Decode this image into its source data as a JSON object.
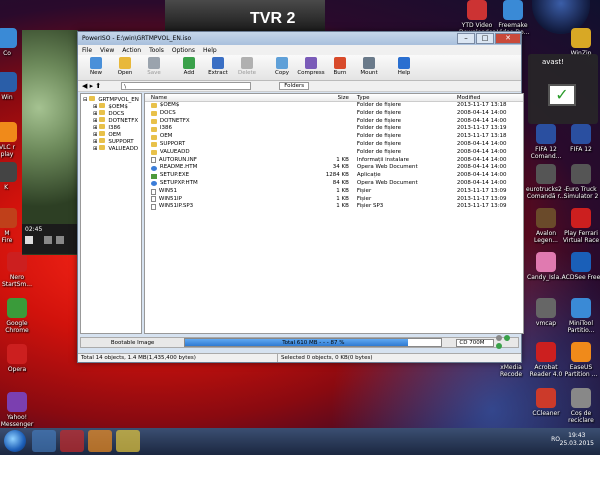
{
  "desktop": {
    "left_icons": [
      {
        "label": "Co",
        "color": "#3a8ad6"
      },
      {
        "label": "Win",
        "color": "#2a5ea8"
      },
      {
        "label": "VLC r\nplay",
        "color": "#f08a1a"
      },
      {
        "label": "K ",
        "color": "#444"
      },
      {
        "label": "M\nFire",
        "color": "#c0401a"
      },
      {
        "label": "Nero\nStartSm...",
        "color": "#cc1f1f"
      },
      {
        "label": "Google\nChrome",
        "color": "#3a9b3a"
      },
      {
        "label": "Opera",
        "color": "#cc1f1f"
      },
      {
        "label": "Yahoo!\nMessenger",
        "color": "#7b3fb0"
      }
    ],
    "right_icons": [
      {
        "label": "YTD Video\nDownloader",
        "color": "#cc3333"
      },
      {
        "label": "Freemake\nVideo Do...",
        "color": "#3a8ad6"
      },
      {
        "label": "WinZip",
        "color": "#d8a825"
      },
      {
        "label": "FIFA 12\nComand...",
        "color": "#2a4fa0"
      },
      {
        "label": "FIFA 12",
        "color": "#2a4fa0"
      },
      {
        "label": "eurotrucks2 -\nComandă r...",
        "color": "#555"
      },
      {
        "label": "Euro Truck\nSimulator 2",
        "color": "#555"
      },
      {
        "label": "Avalon\nLegen...",
        "color": "#6a4a2a"
      },
      {
        "label": "Play Ferrari\nVirtual Race",
        "color": "#cc1f1f"
      },
      {
        "label": "Candy_Isla...",
        "color": "#e07ab0"
      },
      {
        "label": "ACDSee Free",
        "color": "#1a5fb8"
      },
      {
        "label": "vmcap",
        "color": "#666"
      },
      {
        "label": "MiniTool\nPartitio...",
        "color": "#3a8ad6"
      },
      {
        "label": "xMedia\nRecode",
        "color": "#3a3a3a"
      },
      {
        "label": "Acrobat\nReader 4.0",
        "color": "#cc1f1f"
      },
      {
        "label": "EaseUS\nPartition ...",
        "color": "#f08a1a"
      },
      {
        "label": "CCleaner",
        "color": "#cc3a2a"
      },
      {
        "label": "Coș de\nreciclare",
        "color": "#888"
      }
    ],
    "avast_label": "avast!",
    "tv_logo": "TVR 2"
  },
  "video": {
    "time": "02:45"
  },
  "window": {
    "title": "PowerISO - E:\\win\\GRTMPVOL_EN.iso",
    "menu": [
      "File",
      "View",
      "Action",
      "Tools",
      "Options",
      "Help"
    ],
    "toolbar": [
      {
        "label": "New",
        "icon": "new-icon",
        "color": "#4a90d9",
        "enabled": true
      },
      {
        "label": "Open",
        "icon": "open-folder-icon",
        "color": "#e8b83a",
        "enabled": true
      },
      {
        "label": "Save",
        "icon": "save-icon",
        "color": "#9aa3ad",
        "enabled": false
      },
      {
        "label": "Add",
        "icon": "add-icon",
        "color": "#3aa14a",
        "enabled": true
      },
      {
        "label": "Extract",
        "icon": "extract-icon",
        "color": "#3a6fc4",
        "enabled": true
      },
      {
        "label": "Delete",
        "icon": "delete-icon",
        "color": "#b0b0b0",
        "enabled": false
      },
      {
        "label": "Copy",
        "icon": "copy-icon",
        "color": "#5fa0d8",
        "enabled": true
      },
      {
        "label": "Compress",
        "icon": "compress-icon",
        "color": "#7a5bb8",
        "enabled": true
      },
      {
        "label": "Burn",
        "icon": "burn-icon",
        "color": "#d84a2a",
        "enabled": true
      },
      {
        "label": "Mount",
        "icon": "mount-icon",
        "color": "#6a7a8a",
        "enabled": true
      },
      {
        "label": "Help",
        "icon": "help-icon",
        "color": "#2a6fd0",
        "enabled": true
      }
    ],
    "address": "\\",
    "folders_button": "Folders",
    "tree": {
      "root": "GRTMPVOL_EN",
      "children": [
        "$OEM$",
        "DOCS",
        "DOTNETFX",
        "I386",
        "OEM",
        "SUPPORT",
        "VALUEADD"
      ]
    },
    "columns": {
      "name": "Name",
      "size": "Size",
      "type": "Type",
      "modified": "Modified"
    },
    "files": [
      {
        "name": "$OEM$",
        "size": "",
        "type": "Folder de fișiere",
        "modified": "2013-11-17 13:18",
        "kind": "folder"
      },
      {
        "name": "DOCS",
        "size": "",
        "type": "Folder de fișiere",
        "modified": "2008-04-14 14:00",
        "kind": "folder"
      },
      {
        "name": "DOTNETFX",
        "size": "",
        "type": "Folder de fișiere",
        "modified": "2008-04-14 14:00",
        "kind": "folder"
      },
      {
        "name": "I386",
        "size": "",
        "type": "Folder de fișiere",
        "modified": "2013-11-17 13:19",
        "kind": "folder"
      },
      {
        "name": "OEM",
        "size": "",
        "type": "Folder de fișiere",
        "modified": "2013-11-17 13:18",
        "kind": "folder"
      },
      {
        "name": "SUPPORT",
        "size": "",
        "type": "Folder de fișiere",
        "modified": "2008-04-14 14:00",
        "kind": "folder"
      },
      {
        "name": "VALUEADD",
        "size": "",
        "type": "Folder de fișiere",
        "modified": "2008-04-14 14:00",
        "kind": "folder"
      },
      {
        "name": "AUTORUN.INF",
        "size": "1 KB",
        "type": "Informații instalare",
        "modified": "2008-04-14 14:00",
        "kind": "file"
      },
      {
        "name": "README.HTM",
        "size": "34 KB",
        "type": "Opera Web Document",
        "modified": "2008-04-14 14:00",
        "kind": "html"
      },
      {
        "name": "SETUP.EXE",
        "size": "1284 KB",
        "type": "Aplicație",
        "modified": "2008-04-14 14:00",
        "kind": "exe"
      },
      {
        "name": "SETUPXP.HTM",
        "size": "84 KB",
        "type": "Opera Web Document",
        "modified": "2008-04-14 14:00",
        "kind": "html"
      },
      {
        "name": "WIN51",
        "size": "1 KB",
        "type": "Fișier",
        "modified": "2013-11-17 13:09",
        "kind": "file"
      },
      {
        "name": "WIN51IP",
        "size": "1 KB",
        "type": "Fișier",
        "modified": "2013-11-17 13:09",
        "kind": "file"
      },
      {
        "name": "WIN51IP.SP3",
        "size": "1 KB",
        "type": "Fișier SP3",
        "modified": "2013-11-17 13:09",
        "kind": "file"
      }
    ],
    "capacity": {
      "bootable": "Bootable Image",
      "text": "Total  610 MB   - - -  87 %",
      "percent": 87,
      "media": "CD 700M"
    },
    "status_left": "Total 14 objects, 1.4 MB(1,435,400 bytes)",
    "status_right": "Selected 0 objects, 0 KB(0 bytes)"
  },
  "taskbar": {
    "tray_lang": "RO",
    "time": "19:43",
    "date": "25.03.2015"
  }
}
